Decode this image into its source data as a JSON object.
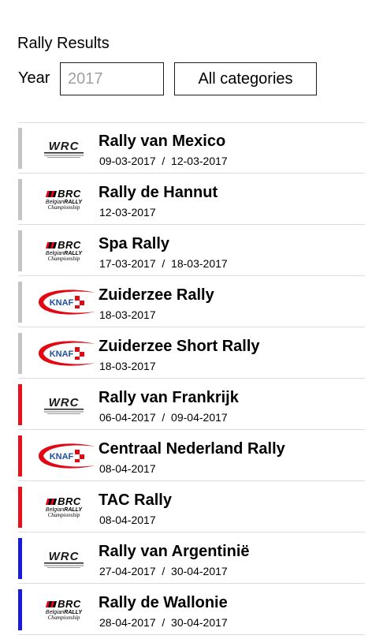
{
  "header": {
    "title": "Rally Results"
  },
  "filters": {
    "year_label": "Year",
    "year_placeholder": "2017",
    "category_label": "All categories"
  },
  "logos": {
    "wrc_text": "WRC",
    "brc_text": "BRC",
    "brc_sub1": "Belgian",
    "brc_sub2": "RALLY",
    "brc_sub3": "Championship",
    "knaf_text": "KNAF"
  },
  "colors": {
    "accent_grey": "#c4c4c4",
    "accent_red": "#e8101d",
    "accent_blue": "#1a1adc",
    "knaf_red": "#e30613",
    "knaf_blue": "#1f4fa3"
  },
  "results": [
    {
      "name": "Rally van Mexico",
      "date": "09-03-2017  /  12-03-2017",
      "logo": "wrc-logo",
      "accent": "grey"
    },
    {
      "name": "Rally de Hannut",
      "date": "12-03-2017",
      "logo": "brc-logo",
      "accent": "grey"
    },
    {
      "name": "Spa Rally",
      "date": "17-03-2017  /  18-03-2017",
      "logo": "brc-logo",
      "accent": "grey"
    },
    {
      "name": "Zuiderzee Rally",
      "date": "18-03-2017",
      "logo": "knaf-logo",
      "accent": "grey"
    },
    {
      "name": "Zuiderzee Short Rally",
      "date": "18-03-2017",
      "logo": "knaf-logo",
      "accent": "grey"
    },
    {
      "name": "Rally van Frankrijk",
      "date": "06-04-2017  /  09-04-2017",
      "logo": "wrc-logo",
      "accent": "red"
    },
    {
      "name": "Centraal Nederland Rally",
      "date": "08-04-2017",
      "logo": "knaf-logo",
      "accent": "red"
    },
    {
      "name": "TAC Rally",
      "date": "08-04-2017",
      "logo": "brc-logo",
      "accent": "red"
    },
    {
      "name": "Rally van Argentinië",
      "date": "27-04-2017  /  30-04-2017",
      "logo": "wrc-logo",
      "accent": "blue"
    },
    {
      "name": "Rally de Wallonie",
      "date": "28-04-2017  /  30-04-2017",
      "logo": "brc-logo",
      "accent": "blue"
    }
  ]
}
